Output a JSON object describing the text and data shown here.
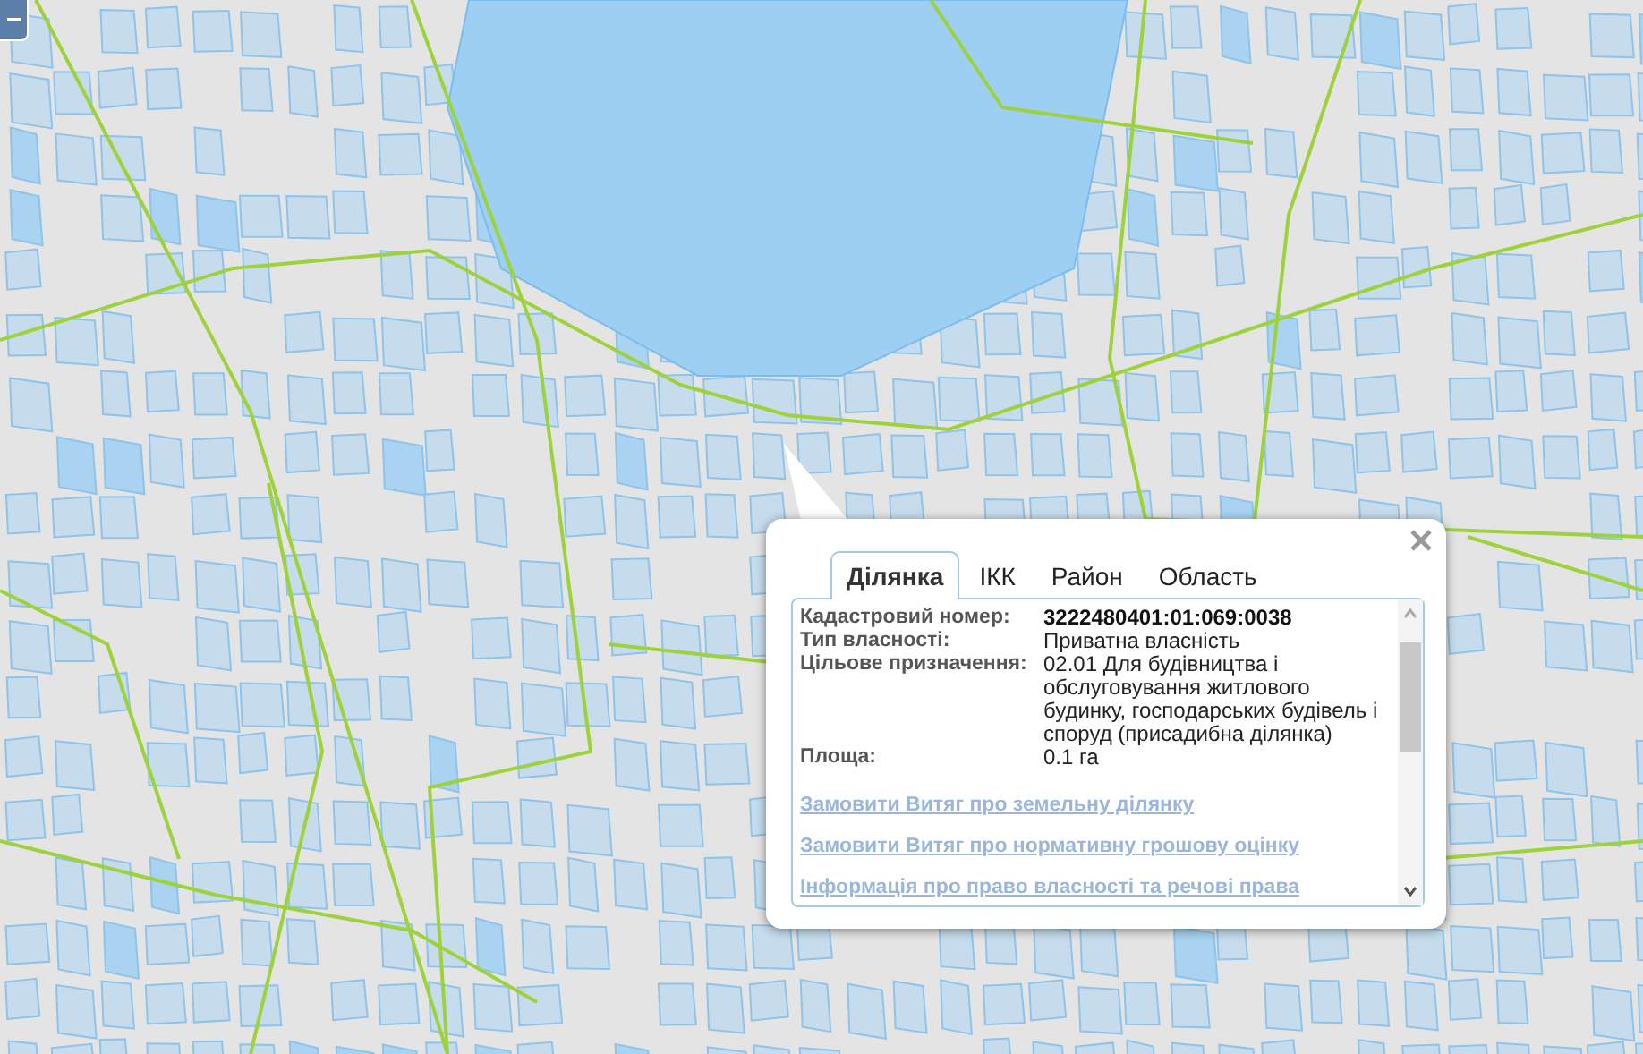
{
  "popup": {
    "tabs": [
      {
        "label": "Ділянка",
        "selected": true
      },
      {
        "label": "ІКК",
        "selected": false
      },
      {
        "label": "Район",
        "selected": false
      },
      {
        "label": "Область",
        "selected": false
      }
    ],
    "fields": [
      {
        "label": "Кадастровий номер:",
        "value": "3222480401:01:069:0038",
        "kind": "strong"
      },
      {
        "label": "Тип власності:",
        "value": "Приватна власність",
        "kind": "plain"
      },
      {
        "label": "Цільове призначення:",
        "value": "02.01 Для будівництва і обслуговування житлового будинку, господарських будівель і споруд (присадибна ділянка)",
        "kind": "wrap"
      },
      {
        "label": "Площа:",
        "value": "0.1 га",
        "kind": "plain"
      }
    ],
    "links": [
      "Замовити Витяг про земельну ділянку",
      "Замовити Витяг про нормативну грошову оцінку",
      "Інформація про право власності та речові права"
    ]
  }
}
